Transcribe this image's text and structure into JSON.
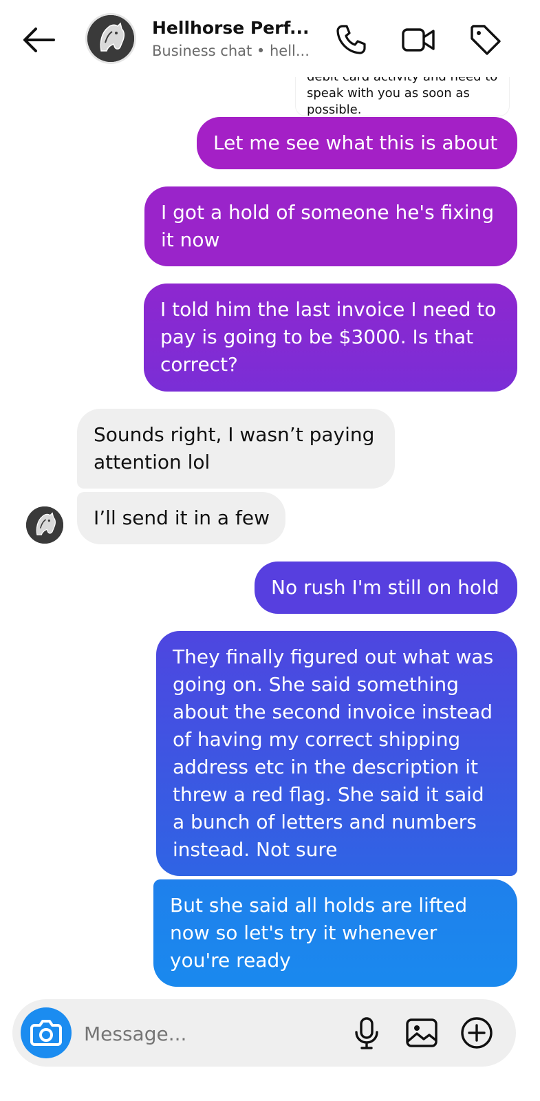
{
  "header": {
    "title": "Hellhorse Perf...",
    "subtitle": "Business chat • hell..."
  },
  "quoted": {
    "text": "debit card activity and need to speak with you as soon as possible."
  },
  "messages": [
    {
      "from": "me",
      "text": "Let me see what this is about"
    },
    {
      "from": "me",
      "text": "I got a hold of someone he's fixing it now"
    },
    {
      "from": "me",
      "text": "I told him the last invoice I need to pay is going to be $3000. Is that correct?"
    },
    {
      "from": "them",
      "text": "Sounds right, I wasn’t paying attention lol"
    },
    {
      "from": "them",
      "text": "I’ll send it in a few"
    },
    {
      "from": "me",
      "text": "No rush I'm still on hold"
    },
    {
      "from": "me",
      "text": "They finally figured out what was going on. She said something about the second invoice instead of having my correct shipping address etc in the description it threw a red flag. She said it said a bunch of letters and numbers instead. Not sure"
    },
    {
      "from": "me",
      "text": "But she said all holds are lifted now so let's try it whenever you're ready"
    }
  ],
  "composer": {
    "placeholder": "Message..."
  },
  "colors": {
    "gradient_top": "#a321c9",
    "gradient_mid": "#5b3be0",
    "gradient_bottom": "#1a87ee",
    "incoming_bg": "#efefef",
    "camera_button": "#1b8cf0"
  },
  "icons": [
    "back-arrow-icon",
    "phone-icon",
    "video-camera-icon",
    "tag-icon",
    "camera-icon",
    "microphone-icon",
    "image-icon",
    "add-circle-icon"
  ]
}
